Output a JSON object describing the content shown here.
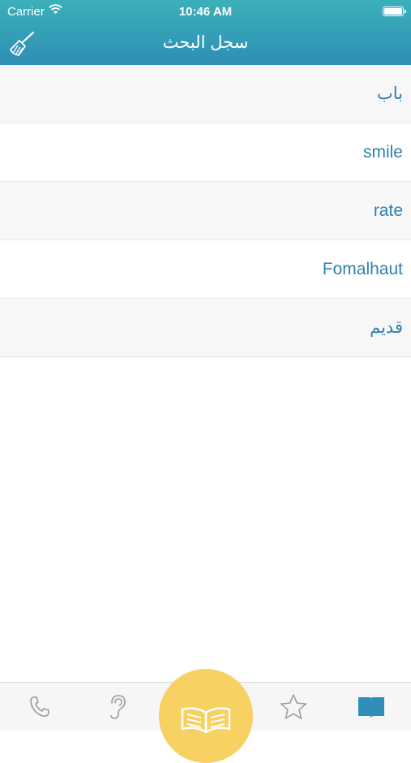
{
  "status_bar": {
    "carrier": "Carrier",
    "time": "10:46 AM"
  },
  "header": {
    "title": "سجل البحث",
    "clear_icon": "broom-icon"
  },
  "history": [
    {
      "text": "باب"
    },
    {
      "text": "smile"
    },
    {
      "text": "rate"
    },
    {
      "text": "Fomalhaut"
    },
    {
      "text": "قديم"
    }
  ],
  "tabbar": {
    "tabs": [
      {
        "icon": "phone-icon"
      },
      {
        "icon": "ear-icon"
      },
      {
        "icon": "open-book-icon",
        "selected_center": true
      },
      {
        "icon": "star-icon"
      },
      {
        "icon": "book-icon",
        "active": true
      }
    ],
    "colors": {
      "active": "#2f8fb8",
      "inactive": "#9a9a9a",
      "center": "#f7d162"
    }
  },
  "colors": {
    "header_top": "#3bb0b9",
    "header_bottom": "#2e8fb4",
    "row_text": "#2f7fb0",
    "row_shade": "#f7f7f7"
  }
}
